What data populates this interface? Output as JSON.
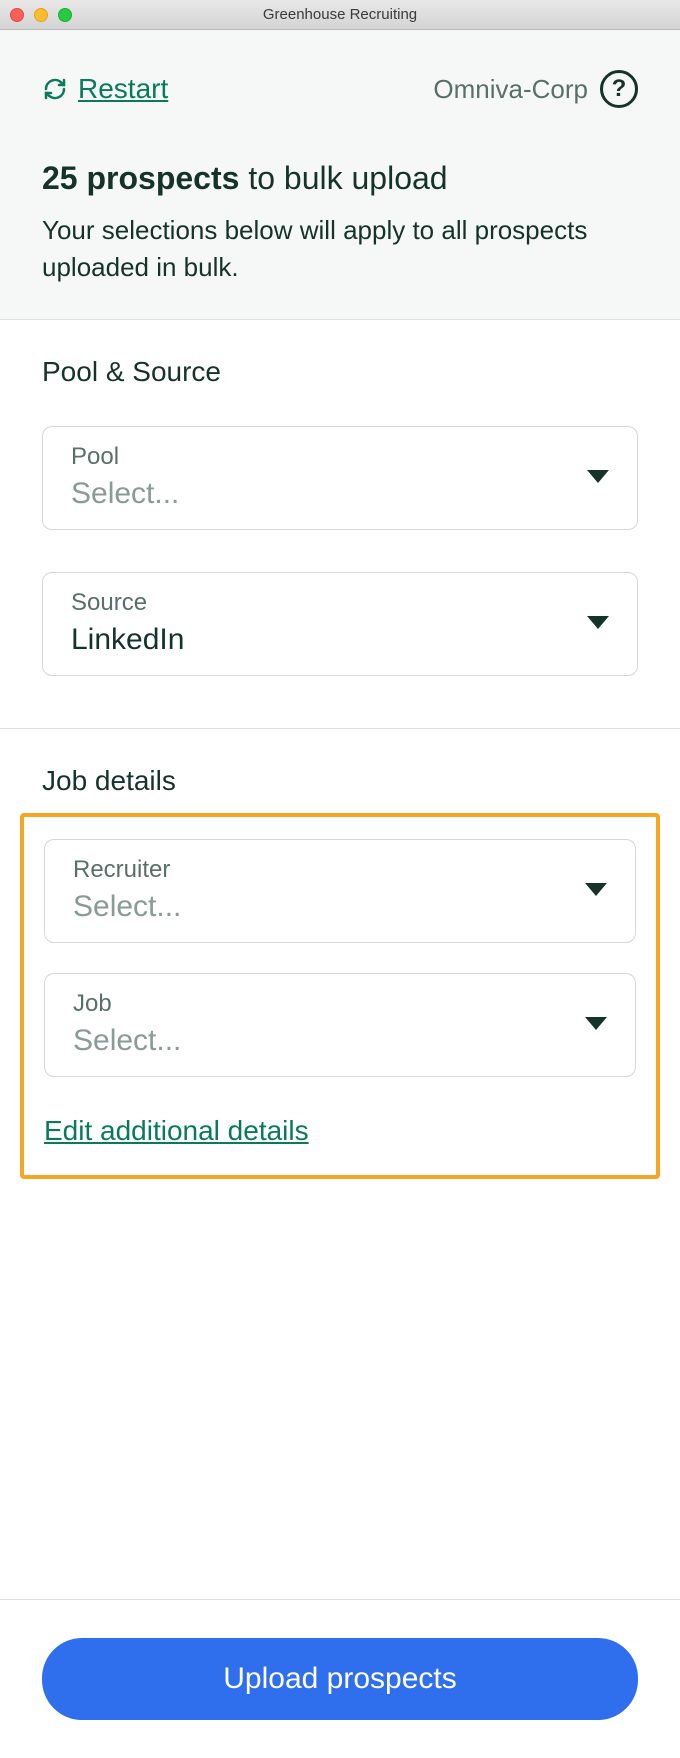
{
  "window": {
    "title": "Greenhouse Recruiting"
  },
  "header": {
    "restart_label": "Restart",
    "org_name": "Omniva-Corp",
    "headline_bold": "25 prospects",
    "headline_rest": " to bulk upload",
    "subhead": "Your selections below will apply to all prospects uploaded in bulk."
  },
  "pool_section": {
    "title": "Pool & Source",
    "pool": {
      "label": "Pool",
      "placeholder": "Select..."
    },
    "source": {
      "label": "Source",
      "value": "LinkedIn"
    }
  },
  "job_section": {
    "title": "Job details",
    "recruiter": {
      "label": "Recruiter",
      "placeholder": "Select..."
    },
    "job": {
      "label": "Job",
      "placeholder": "Select..."
    },
    "edit_link": "Edit additional details"
  },
  "footer": {
    "upload_label": "Upload prospects"
  }
}
